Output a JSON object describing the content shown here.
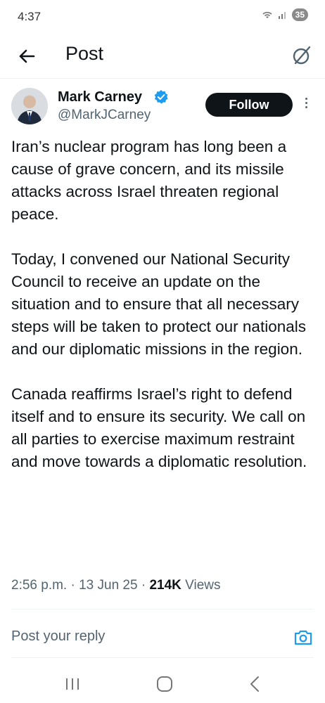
{
  "status_bar": {
    "time": "4:37",
    "battery": "35"
  },
  "header": {
    "title": "Post",
    "back_icon": "arrow-left-icon",
    "grok_icon": "grok-icon"
  },
  "author": {
    "name": "Mark Carney",
    "handle": "@MarkJCarney",
    "verified": true,
    "follow_label": "Follow"
  },
  "post": {
    "paragraphs": [
      "Iran’s nuclear program has long been a cause of grave concern, and its missile attacks across Israel threaten regional peace.",
      "Today, I convened our National Security Council to receive an update on the situation and to ensure that all necessary steps will be taken to protect our nationals and our diplomatic missions in the region.",
      "Canada reaffirms Israel’s right to defend itself and to ensure its security. We call on all parties to exercise maximum restraint and move towards a diplomatic resolution."
    ],
    "time": "2:56 p.m.",
    "date": "13 Jun 25",
    "views_count": "214K",
    "views_label": "Views"
  },
  "reply": {
    "placeholder": "Post your reply"
  },
  "colors": {
    "text": "#0f1419",
    "secondary": "#536471",
    "verified": "#1d9bf0",
    "accent": "#1d9bf0"
  }
}
